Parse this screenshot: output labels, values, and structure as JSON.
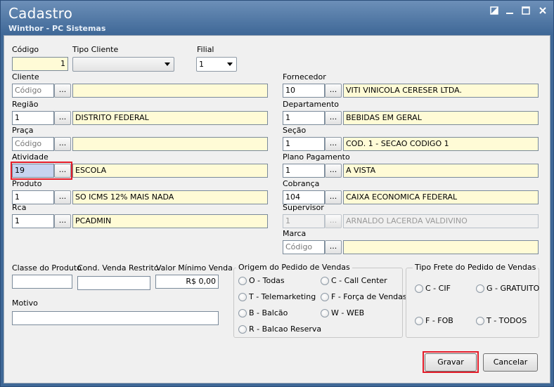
{
  "window": {
    "title": "Cadastro",
    "subtitle": "Winthor - PC Sistemas",
    "buttons": [
      "restore-icon",
      "minimize-icon",
      "maximize-icon",
      "close-icon"
    ]
  },
  "top": {
    "codigo_label": "Código",
    "codigo_value": "1",
    "tipo_cliente_label": "Tipo Cliente",
    "tipo_cliente_value": "",
    "filial_label": "Filial",
    "filial_value": "1"
  },
  "left": {
    "cliente": {
      "label": "Cliente",
      "code": "Código",
      "desc": ""
    },
    "regiao": {
      "label": "Região",
      "code": "1",
      "desc": "DISTRITO FEDERAL"
    },
    "praca": {
      "label": "Praça",
      "code": "Código",
      "desc": ""
    },
    "atividade": {
      "label": "Atividade",
      "code": "19",
      "desc": "ESCOLA"
    },
    "produto": {
      "label": "Produto",
      "code": "1",
      "desc": "SO ICMS 12% MAIS NADA"
    },
    "rca": {
      "label": "Rca",
      "code": "1",
      "desc": "PCADMIN"
    }
  },
  "right": {
    "fornecedor": {
      "label": "Fornecedor",
      "code": "10",
      "desc": "VITI VINICOLA CERESER LTDA."
    },
    "departamento": {
      "label": "Departamento",
      "code": "1",
      "desc": "BEBIDAS EM GERAL"
    },
    "secao": {
      "label": "Seção",
      "code": "1",
      "desc": "COD. 1 - SECAO CODIGO 1"
    },
    "plano": {
      "label": "Plano Pagamento",
      "code": "1",
      "desc": "A VISTA"
    },
    "cobranca": {
      "label": "Cobrança",
      "code": "104",
      "desc": "CAIXA ECONOMICA FEDERAL"
    },
    "supervisor": {
      "label": "Supervisor",
      "code": "1",
      "desc": "ARNALDO LACERDA VALDIVINO"
    },
    "marca": {
      "label": "Marca",
      "code": "Código",
      "desc": ""
    }
  },
  "dots_label": "...",
  "bottom": {
    "classe_label": "Classe do Produto",
    "classe_value": "",
    "cond_label": "Cond. Venda Restrito",
    "cond_value": "",
    "valor_label": "Valor Mínimo Venda",
    "valor_value": "R$ 0,00",
    "motivo_label": "Motivo",
    "motivo_value": ""
  },
  "origem": {
    "title": "Origem do Pedido de Vendas",
    "options": [
      "O - Todas",
      "C - Call Center",
      "T - Telemarketing",
      "F - Força de Vendas",
      "B - Balcão",
      "W - WEB",
      "R - Balcao Reserva"
    ]
  },
  "frete": {
    "title": "Tipo Frete do Pedido de Vendas",
    "options": [
      "C - CIF",
      "G - GRATUITO",
      "F - FOB",
      "T - TODOS"
    ]
  },
  "actions": {
    "gravar": "Gravar",
    "cancelar": "Cancelar"
  },
  "colors": {
    "title_bar": "#3f6897",
    "field_yellow": "#fffbd6",
    "highlight_red": "#e41d2a"
  }
}
